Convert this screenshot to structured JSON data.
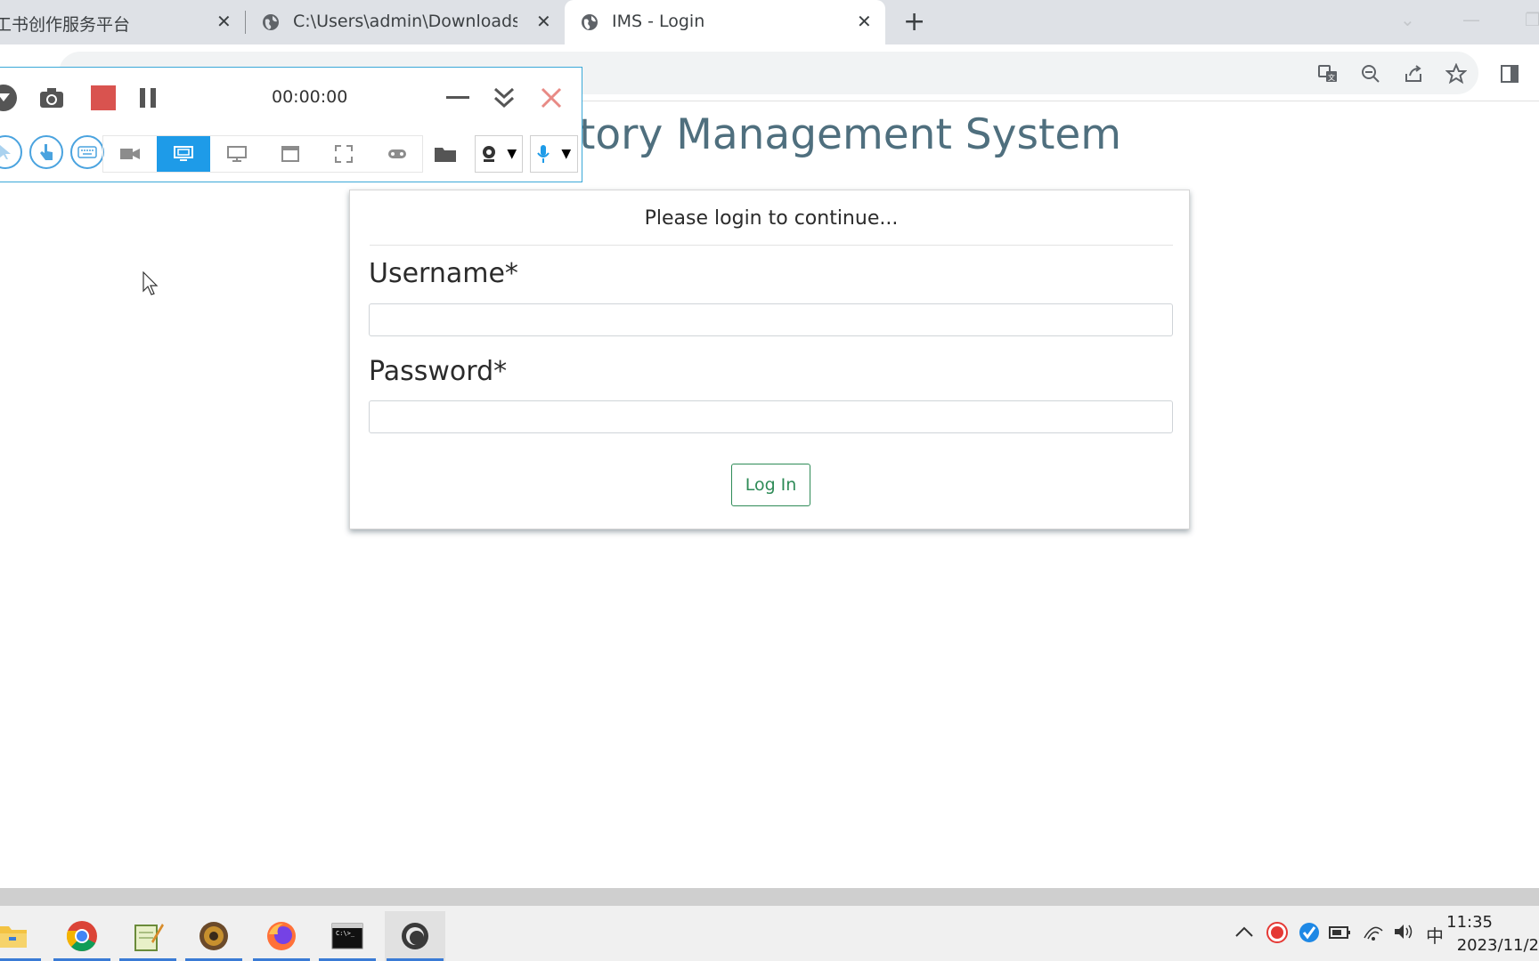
{
  "browser": {
    "tabs": [
      {
        "title": "工书创作服务平台",
        "active": false
      },
      {
        "title": "C:\\Users\\admin\\Downloads\\",
        "active": false
      },
      {
        "title": "IMS - Login",
        "active": true
      }
    ],
    "toolbar_icons": [
      "translate-icon",
      "zoom-out-icon",
      "share-icon",
      "star-icon",
      "side-panel-icon"
    ]
  },
  "recorder": {
    "timer": "00:00:00"
  },
  "page": {
    "title": "tory Management System",
    "card_header": "Please login to continue...",
    "username_label": "Username*",
    "username_value": "",
    "password_label": "Password*",
    "password_value": "",
    "login_button": "Log In"
  },
  "taskbar": {
    "apps": [
      "file-explorer",
      "chrome",
      "notepad",
      "settings-app",
      "firefox",
      "terminal",
      "recorder-app"
    ],
    "clock_time": "11:35",
    "clock_date": "2023/11/2",
    "ime": "中"
  },
  "colors": {
    "title": "#4f6f7e",
    "button_accent": "#2e8b57",
    "recorder_active": "#1e9be8",
    "recorder_stop": "#d9534f"
  }
}
